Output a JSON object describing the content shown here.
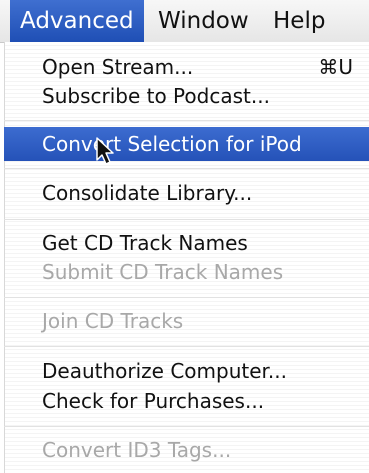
{
  "menubar": {
    "titles": [
      "Advanced",
      "Window",
      "Help"
    ]
  },
  "menu": {
    "items": [
      {
        "label": "Open Stream...",
        "shortcut": "⌘U",
        "enabled": true
      },
      {
        "label": "Subscribe to Podcast...",
        "enabled": true
      },
      {
        "label": "Convert Selection for iPod",
        "enabled": true,
        "highlighted": true
      },
      {
        "label": "Consolidate Library...",
        "enabled": true
      },
      {
        "label": "Get CD Track Names",
        "enabled": true
      },
      {
        "label": "Submit CD Track Names",
        "enabled": false
      },
      {
        "label": "Join CD Tracks",
        "enabled": false
      },
      {
        "label": "Deauthorize Computer...",
        "enabled": true
      },
      {
        "label": "Check for Purchases...",
        "enabled": true
      },
      {
        "label": "Convert ID3 Tags...",
        "enabled": false
      }
    ]
  },
  "colors": {
    "highlight": "#2a5ac0",
    "disabled_text": "#a8a8a8"
  }
}
